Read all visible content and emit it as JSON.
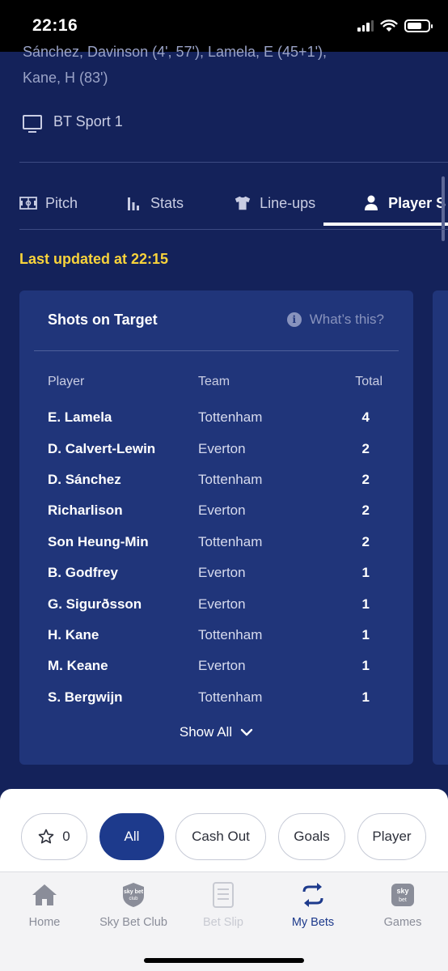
{
  "status_bar": {
    "time": "22:16"
  },
  "match_info": {
    "scorers_line1": "Sánchez, Davinson (4', 57'), Lamela, E (45+1'),",
    "scorers_line2": "Kane, H (83')",
    "tv_channel": "BT Sport 1"
  },
  "tabs": [
    {
      "label": "Pitch",
      "icon": "pitch-icon"
    },
    {
      "label": "Stats",
      "icon": "stats-icon"
    },
    {
      "label": "Line-ups",
      "icon": "shirt-icon"
    },
    {
      "label": "Player S",
      "icon": "person-icon"
    }
  ],
  "last_updated": "Last updated at 22:15",
  "card": {
    "title": "Shots on Target",
    "whats_this": "What’s this?",
    "columns": {
      "player": "Player",
      "team": "Team",
      "total": "Total"
    },
    "rows": [
      {
        "player": "E. Lamela",
        "team": "Tottenham",
        "total": "4"
      },
      {
        "player": "D. Calvert-Lewin",
        "team": "Everton",
        "total": "2"
      },
      {
        "player": "D. Sánchez",
        "team": "Tottenham",
        "total": "2"
      },
      {
        "player": "Richarlison",
        "team": "Everton",
        "total": "2"
      },
      {
        "player": "Son Heung-Min",
        "team": "Tottenham",
        "total": "2"
      },
      {
        "player": "B. Godfrey",
        "team": "Everton",
        "total": "1"
      },
      {
        "player": "G. Sigurðsson",
        "team": "Everton",
        "total": "1"
      },
      {
        "player": "H. Kane",
        "team": "Tottenham",
        "total": "1"
      },
      {
        "player": "M. Keane",
        "team": "Everton",
        "total": "1"
      },
      {
        "player": "S. Bergwijn",
        "team": "Tottenham",
        "total": "1"
      }
    ],
    "show_all": "Show All"
  },
  "filters": {
    "favourites_count": "0",
    "all": "All",
    "cash_out": "Cash Out",
    "goals": "Goals",
    "player": "Player"
  },
  "bottom_nav": {
    "home": "Home",
    "sky_bet_club": "Sky Bet Club",
    "bet_slip": "Bet Slip",
    "my_bets": "My Bets",
    "games": "Games"
  },
  "colors": {
    "background": "#14225a",
    "card": "#20357a",
    "highlight_yellow": "#f8d33b",
    "active_blue": "#1d3a8c"
  }
}
